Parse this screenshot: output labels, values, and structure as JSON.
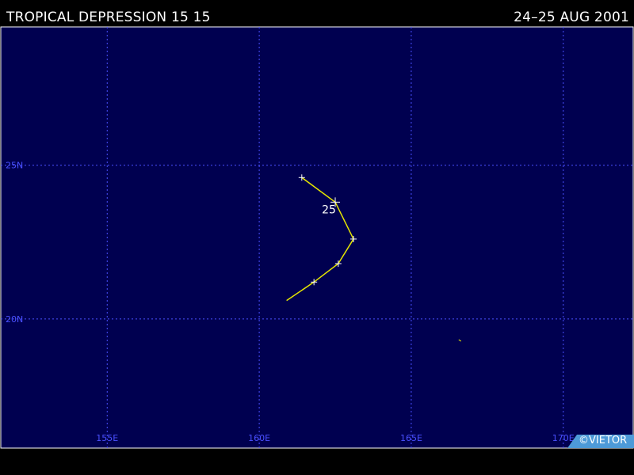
{
  "header": {
    "storm_name": "TROPICAL DEPRESSION 15 15",
    "date_range": "24–25 AUG 2001"
  },
  "credit": "©VIETOR",
  "colors": {
    "ocean": "#000050",
    "grid": "#4a50ff",
    "track": "#e6e600",
    "border": "#ffffff",
    "credit_bg": "#4d9ad8"
  },
  "chart_data": {
    "type": "line",
    "map": {
      "lon_range": [
        151.5,
        172.3
      ],
      "lat_range": [
        15.8,
        29.5
      ],
      "lon_ticks": [
        155,
        160,
        165,
        170
      ],
      "lon_tick_labels": [
        "155E",
        "160E",
        "165E",
        "170E"
      ],
      "lat_ticks": [
        20,
        25
      ],
      "lat_tick_labels": [
        "20N",
        "25N"
      ],
      "grid": true
    },
    "track": {
      "points": [
        {
          "lon": 160.9,
          "lat": 20.6
        },
        {
          "lon": 161.8,
          "lat": 21.2
        },
        {
          "lon": 162.6,
          "lat": 21.8
        },
        {
          "lon": 163.1,
          "lat": 22.6
        },
        {
          "lon": 162.5,
          "lat": 23.8
        },
        {
          "lon": 161.4,
          "lat": 24.6
        }
      ],
      "markers": [
        {
          "lon": 161.8,
          "lat": 21.2,
          "label": ""
        },
        {
          "lon": 162.6,
          "lat": 21.8,
          "label": ""
        },
        {
          "lon": 163.1,
          "lat": 22.6,
          "label": ""
        },
        {
          "lon": 162.5,
          "lat": 23.8,
          "label": "25"
        },
        {
          "lon": 161.4,
          "lat": 24.6,
          "label": ""
        }
      ]
    },
    "islands": [
      {
        "lon": 166.6,
        "lat": 19.3
      }
    ]
  }
}
